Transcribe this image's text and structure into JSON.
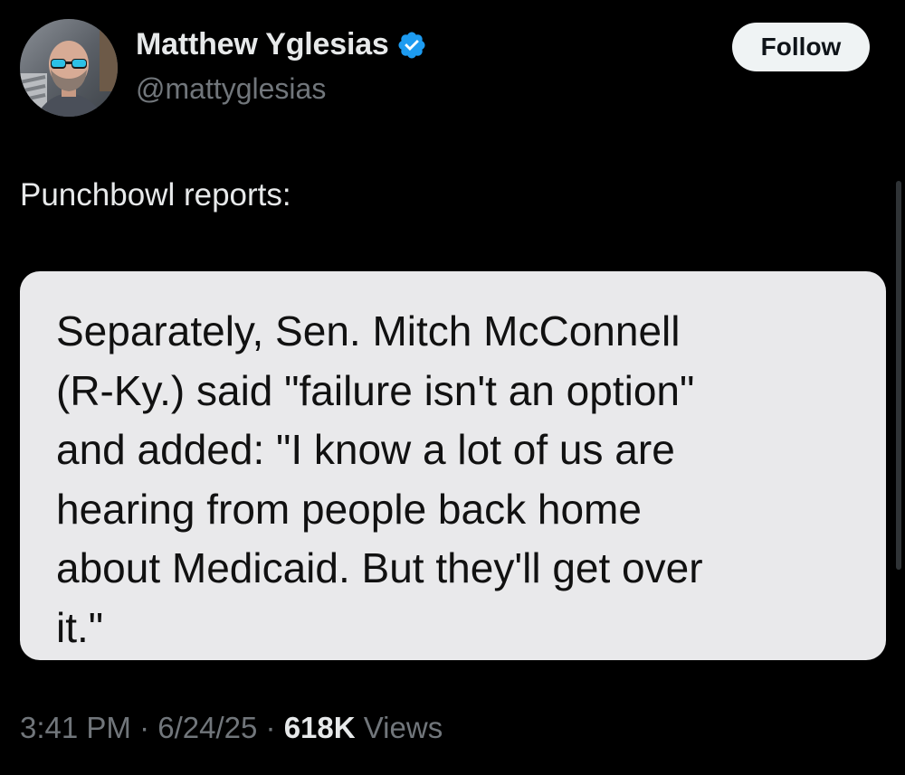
{
  "author": {
    "name": "Matthew Yglesias",
    "handle": "@mattyglesias",
    "verified": true,
    "avatar_icon": "profile-photo-avatar",
    "verified_icon": "verified-badge-icon"
  },
  "follow_button": {
    "label": "Follow"
  },
  "tweet": {
    "text": "Punchbowl reports:"
  },
  "quote_image": {
    "text": "Separately, Sen. Mitch McConnell\n(R-Ky.) said \"failure isn't an option\"\nand added: \"I know a lot of us are\nhearing from people back home\nabout Medicaid. But they'll get over\nit.\""
  },
  "meta": {
    "time": "3:41 PM",
    "separator": "·",
    "date": "6/24/25",
    "views_count": "618K",
    "views_label": "Views"
  },
  "colors": {
    "background": "#000000",
    "primary_text": "#e7e9ea",
    "secondary_text": "#71767b",
    "verified_blue": "#1d9bf0",
    "follow_button_bg": "#eff3f4",
    "quote_card_bg": "#e9e9eb"
  }
}
